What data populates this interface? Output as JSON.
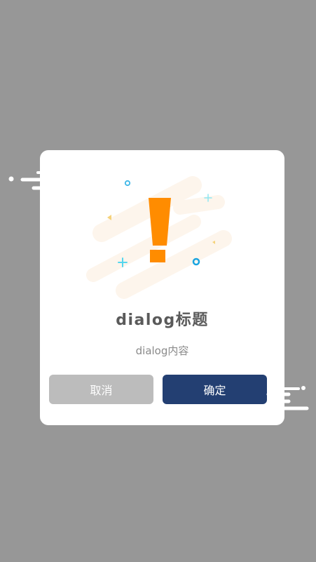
{
  "dialog": {
    "title": "dialog标题",
    "content": "dialog内容",
    "cancel_label": "取消",
    "confirm_label": "确定",
    "icon": "exclamation-icon"
  },
  "colors": {
    "overlay": "#979797",
    "dialog_background": "#ffffff",
    "accent_orange": "#ff8c00",
    "confirm_button": "#233f72",
    "cancel_button": "#bcbcbc",
    "sparkle_blue": "#3fb7e8",
    "sparkle_cyan": "#6fe0f0",
    "sparkle_yellow": "#f5d27a",
    "title_text": "#5a5a5a",
    "content_text": "#8a8a8a"
  }
}
